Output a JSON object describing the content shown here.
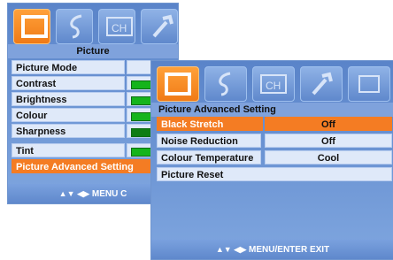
{
  "back_menu": {
    "title": "Picture",
    "items": [
      {
        "label": "Picture Mode"
      },
      {
        "label": "Contrast"
      },
      {
        "label": "Brightness"
      },
      {
        "label": "Colour"
      },
      {
        "label": "Sharpness"
      },
      {
        "label": "Tint"
      },
      {
        "label": "Picture Advanced Setting",
        "selected": true
      }
    ],
    "nav_hint": "MENU C"
  },
  "front_menu": {
    "title": "Picture Advanced Setting",
    "items": [
      {
        "label": "Black Stretch",
        "value": "Off",
        "selected": true
      },
      {
        "label": "Noise Reduction",
        "value": "Off"
      },
      {
        "label": "Colour Temperature",
        "value": "Cool"
      },
      {
        "label": "Picture Reset",
        "value": ""
      }
    ],
    "nav_hint": "MENU/ENTER EXIT"
  },
  "tabs": [
    {
      "icon": "picture-icon",
      "active": true
    },
    {
      "icon": "sound-icon",
      "active": false
    },
    {
      "icon": "channel-icon",
      "active": false
    },
    {
      "icon": "setup-icon",
      "active": false
    },
    {
      "icon": "feature-icon",
      "active": false
    }
  ],
  "colors": {
    "accent": "#f47c23",
    "panel": "#6f95cf",
    "bar": "#15b41c"
  }
}
